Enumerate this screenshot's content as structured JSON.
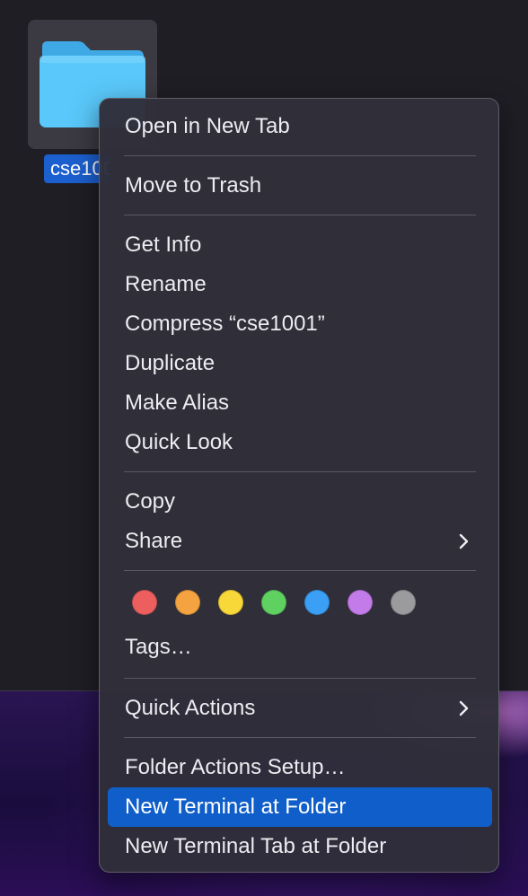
{
  "folder": {
    "label": "cse1001",
    "icon": "folder-icon",
    "icon_color": "#5ac8fa",
    "selection_color": "#1c5fcf"
  },
  "menu": {
    "groups": [
      {
        "items": [
          {
            "label": "Open in New Tab"
          }
        ]
      },
      {
        "items": [
          {
            "label": "Move to Trash"
          }
        ]
      },
      {
        "items": [
          {
            "label": "Get Info"
          },
          {
            "label": "Rename"
          },
          {
            "label": "Compress “cse1001”"
          },
          {
            "label": "Duplicate"
          },
          {
            "label": "Make Alias"
          },
          {
            "label": "Quick Look"
          }
        ]
      },
      {
        "items": [
          {
            "label": "Copy"
          },
          {
            "label": "Share",
            "submenu": true,
            "icon": "chevron-right-icon"
          }
        ]
      },
      {
        "tags": [
          {
            "name": "Red",
            "color": "#ec5f5e"
          },
          {
            "name": "Orange",
            "color": "#f4a340"
          },
          {
            "name": "Yellow",
            "color": "#f8d838"
          },
          {
            "name": "Green",
            "color": "#5ed160"
          },
          {
            "name": "Blue",
            "color": "#3a9ff5"
          },
          {
            "name": "Purple",
            "color": "#c37bea"
          },
          {
            "name": "Gray",
            "color": "#9b9b9e"
          }
        ],
        "items": [
          {
            "label": "Tags…"
          }
        ]
      },
      {
        "items": [
          {
            "label": "Quick Actions",
            "submenu": true,
            "icon": "chevron-right-icon"
          }
        ]
      },
      {
        "items": [
          {
            "label": "Folder Actions Setup…"
          },
          {
            "label": "New Terminal at Folder",
            "highlighted": true
          },
          {
            "label": "New Terminal Tab at Folder"
          }
        ]
      }
    ],
    "highlight_color": "#0f5ec9"
  }
}
